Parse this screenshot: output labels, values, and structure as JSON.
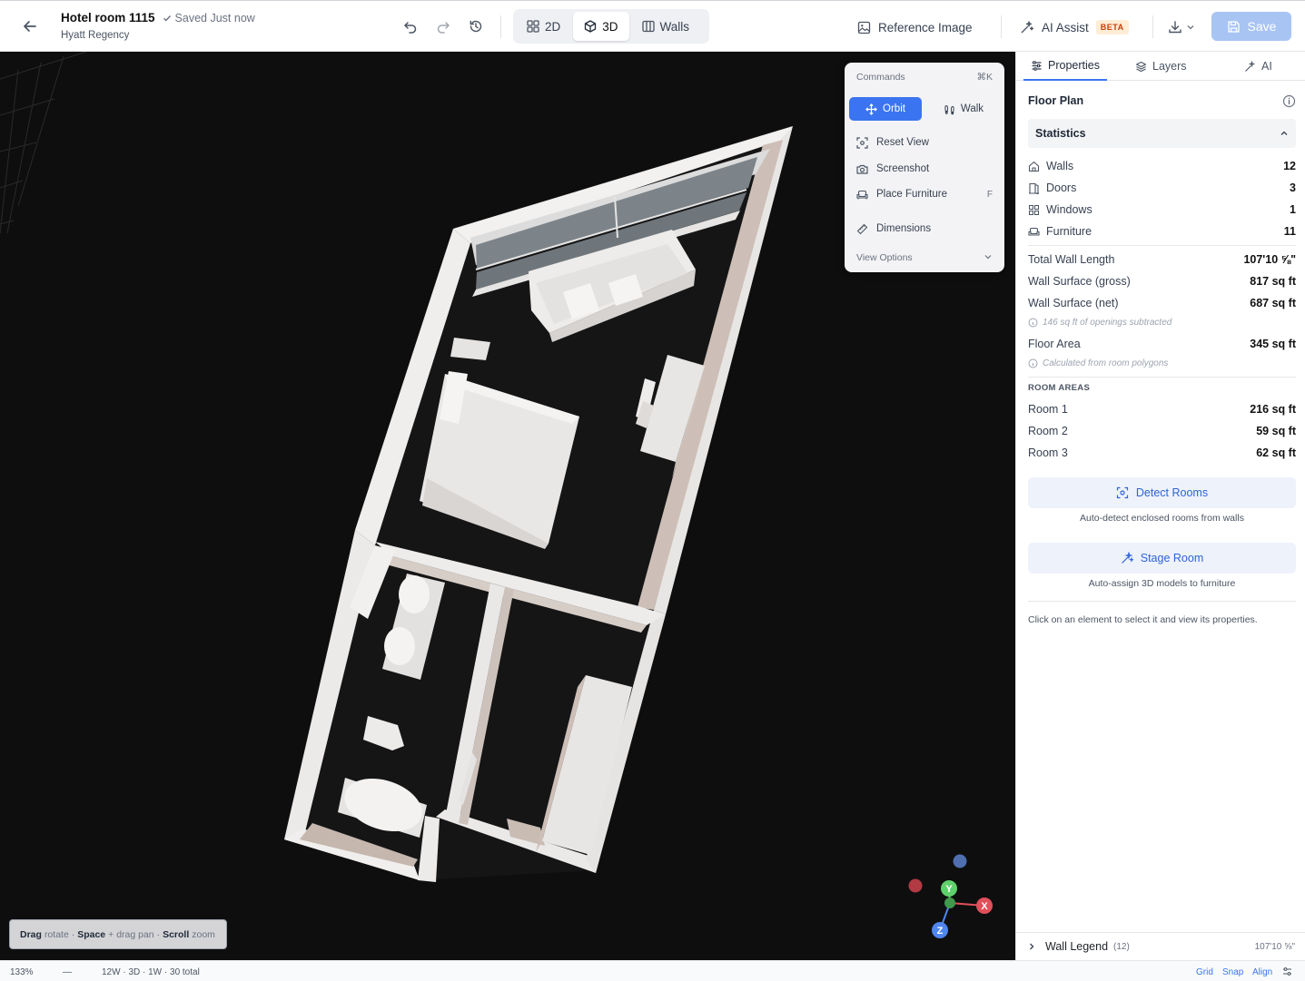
{
  "header": {
    "title": "Hotel room 1115",
    "saved_status": "Saved Just now",
    "subtitle": "Hyatt Regency",
    "view_modes": [
      "2D",
      "3D",
      "Walls"
    ],
    "active_view": "3D",
    "reference_image": "Reference Image",
    "ai_assist": "AI Assist",
    "beta_badge": "BETA",
    "save_label": "Save"
  },
  "commands": {
    "title": "Commands",
    "shortcut": "⌘K",
    "modes": [
      "Orbit",
      "Walk"
    ],
    "active_mode": "Orbit",
    "items": [
      {
        "label": "Reset View",
        "icon": "reset-view-icon",
        "shortcut": ""
      },
      {
        "label": "Screenshot",
        "icon": "camera-icon",
        "shortcut": ""
      },
      {
        "label": "Place Furniture",
        "icon": "sofa-icon",
        "shortcut": "F"
      },
      {
        "label": "Dimensions",
        "icon": "ruler-icon",
        "shortcut": ""
      }
    ],
    "view_options": "View Options"
  },
  "hint": {
    "drag": "Drag",
    "drag_action": "rotate ·",
    "space": "Space",
    "space_action": "+ drag pan ·",
    "scroll": "Scroll",
    "scroll_action": "zoom"
  },
  "axes": {
    "x": "X",
    "y": "Y",
    "z": "Z"
  },
  "sidebar": {
    "tabs": [
      "Properties",
      "Layers",
      "AI"
    ],
    "active_tab": "Properties",
    "section_title": "Floor Plan",
    "statistics_title": "Statistics",
    "counts": [
      {
        "label": "Walls",
        "value": "12",
        "icon": "house-icon"
      },
      {
        "label": "Doors",
        "value": "3",
        "icon": "door-icon"
      },
      {
        "label": "Windows",
        "value": "1",
        "icon": "window-icon"
      },
      {
        "label": "Furniture",
        "value": "11",
        "icon": "sofa-icon"
      }
    ],
    "measures": [
      {
        "label": "Total Wall Length",
        "value": "107'10 ⅝\""
      },
      {
        "label": "Wall Surface (gross)",
        "value": "817 sq ft"
      },
      {
        "label": "Wall Surface (net)",
        "value": "687 sq ft"
      }
    ],
    "openings_note": "146 sq ft of openings subtracted",
    "floor_area_label": "Floor Area",
    "floor_area_value": "345 sq ft",
    "floor_area_note": "Calculated from room polygons",
    "room_areas_title": "ROOM AREAS",
    "rooms": [
      {
        "label": "Room 1",
        "value": "216 sq ft"
      },
      {
        "label": "Room 2",
        "value": "59 sq ft"
      },
      {
        "label": "Room 3",
        "value": "62 sq ft"
      }
    ],
    "detect_rooms": "Detect Rooms",
    "detect_rooms_caption": "Auto-detect enclosed rooms from walls",
    "stage_room": "Stage Room",
    "stage_room_caption": "Auto-assign 3D models to furniture",
    "click_note": "Click on an element to select it and view its properties.",
    "wall_legend": "Wall Legend",
    "wall_legend_count": "(12)",
    "wall_legend_length": "107'10 ⅝\""
  },
  "statusbar": {
    "zoom": "133%",
    "dash": "—",
    "summary": "12W · 3D · 1W · 30 total",
    "grid": "Grid",
    "snap": "Snap",
    "align": "Align"
  },
  "colors": {
    "accent": "#3b74f0",
    "viewport_bg": "#0e0e0f",
    "wall": "#ecebea",
    "axis_x": "#e0505a",
    "axis_y": "#5fd16b",
    "axis_z": "#4f86f0"
  }
}
